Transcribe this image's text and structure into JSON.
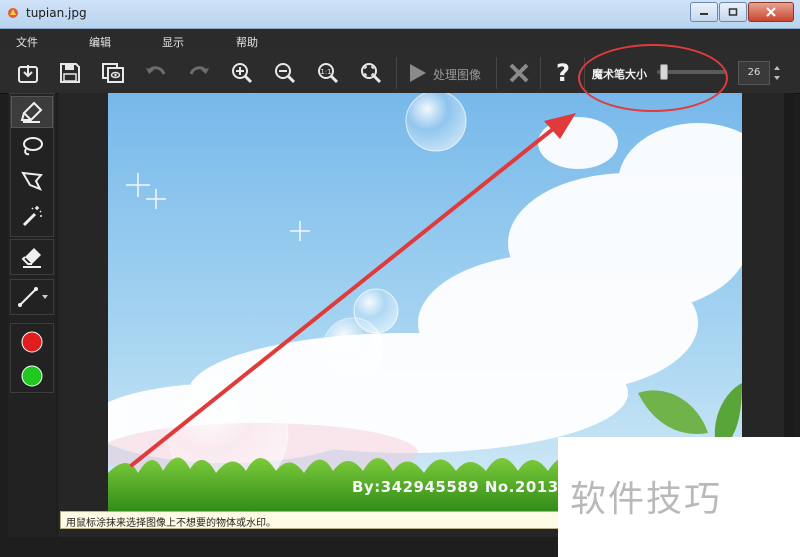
{
  "window": {
    "title": "tupian.jpg"
  },
  "menu": {
    "items": [
      "文件",
      "编辑",
      "显示",
      "帮助"
    ]
  },
  "toolbar": {
    "process_label": "处理图像",
    "help_glyph": "?",
    "magic_size_label": "魔术笔大小",
    "magic_size_value": "26",
    "magic_size_fraction": 0.04
  },
  "left_tools": {
    "color_red": "#e01e1e",
    "color_green": "#1ec81e"
  },
  "image": {
    "credit_text": "By:342945589 No.2013"
  },
  "status": {
    "hint": "用鼠标涂抹来选择图像上不想要的物体或水印。"
  },
  "watermark": {
    "text": "软件技巧"
  },
  "colors": {
    "annotation": "#e03a3a",
    "sky": "#8cc4ec",
    "grass": "#4fa42a"
  }
}
